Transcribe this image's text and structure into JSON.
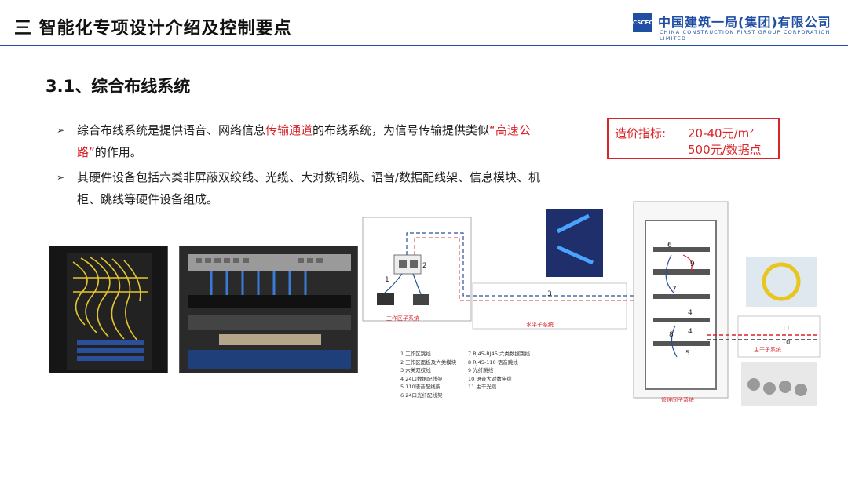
{
  "header": {
    "title": "三  智能化专项设计介绍及控制要点",
    "company_cn": "中国建筑一局(集团)有限公司",
    "company_en": "CHINA CONSTRUCTION FIRST GROUP CORPORATION LIMITED",
    "logo_text": "CSCEC",
    "brand_color": "#1f4ea3"
  },
  "section": {
    "title": "3.1、综合布线系统"
  },
  "bullets": {
    "mark": "➢",
    "b1_part1": "综合布线系统是提供语音、网络信息",
    "b1_red1": "传输通道",
    "b1_part2": "的布线系统，为信号传输提供类似",
    "b1_red2": "“高速公路”",
    "b1_part3": "的作用。",
    "b2": "其硬件设备包括六类非屏蔽双绞线、光缆、大对数铜缆、语音/数据配线架、信息模块、机柜、跳线等硬件设备组成。"
  },
  "cost": {
    "label": "造价指标:",
    "value1": "20-40元/m²",
    "value2": "500元/数据点",
    "color": "#d9242a"
  },
  "diagram": {
    "work_area": "工作区子系统",
    "horizontal": "水平子系统",
    "management": "管理间子系统",
    "backbone": "主干子系统",
    "nums": [
      "1",
      "2",
      "3",
      "4",
      "4",
      "5",
      "6",
      "7",
      "8",
      "9",
      "10",
      "11"
    ],
    "legend_left": [
      "1  工作区跳线",
      "2  工作区面板及六类模块",
      "3  六类双绞线",
      "4  24口数据配线架",
      "5  110语音配线架",
      "6  24口光纤配线架"
    ],
    "legend_right": [
      "7  RJ45-RJ45 六类数据跳线",
      "8  RJ45-110 语音跳线",
      "9  光纤跳线",
      "10  语音大对数电缆",
      "11  主干光缆"
    ]
  }
}
